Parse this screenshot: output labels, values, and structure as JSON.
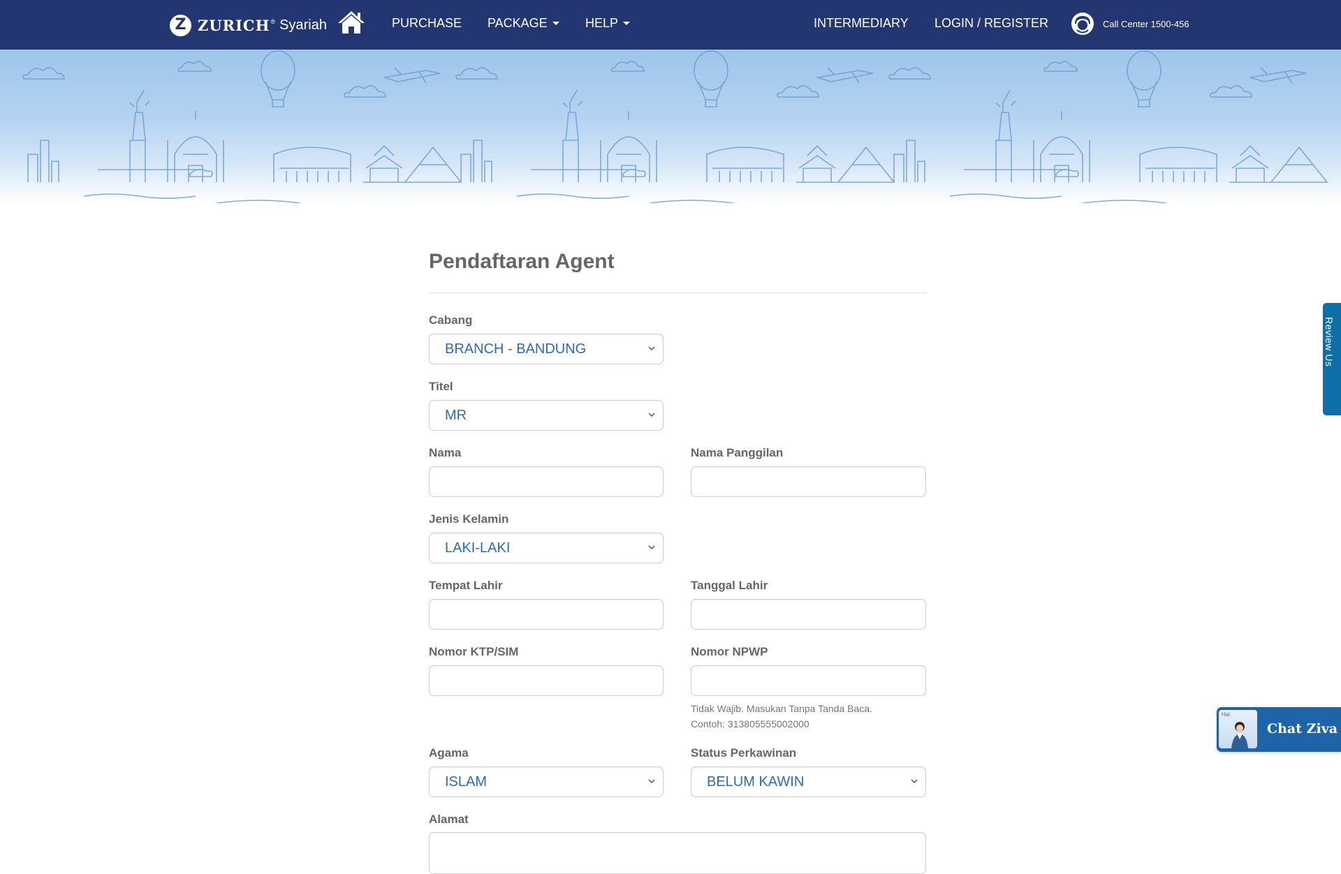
{
  "nav": {
    "logo_text": "ZURICH",
    "logo_sup": "®",
    "logo_sub": "Syariah",
    "purchase": "PURCHASE",
    "package": "PACKAGE",
    "help": "HELP",
    "intermediary": "INTERMEDIARY",
    "login": "LOGIN / REGISTER",
    "call_center": "Call Center 1500-456"
  },
  "form": {
    "title": "Pendaftaran Agent",
    "cabang_label": "Cabang",
    "cabang_value": "BRANCH - BANDUNG",
    "titel_label": "Titel",
    "titel_value": "MR",
    "nama_label": "Nama",
    "panggilan_label": "Nama Panggilan",
    "kelamin_label": "Jenis Kelamin",
    "kelamin_value": "LAKI-LAKI",
    "tempat_label": "Tempat Lahir",
    "tanggal_label": "Tanggal Lahir",
    "ktp_label": "Nomor KTP/SIM",
    "npwp_label": "Nomor NPWP",
    "npwp_help_1": "Tidak Wajib. Masukan Tanpa Tanda Baca.",
    "npwp_help_2": "Contoh: 313805555002000",
    "agama_label": "Agama",
    "agama_value": "ISLAM",
    "status_label": "Status Perkawinan",
    "status_value": "BELUM KAWIN",
    "alamat_label": "Alamat"
  },
  "widgets": {
    "review": "Review Us",
    "chat": "Chat Ziva",
    "chat_greeting": "Hai"
  },
  "colors": {
    "navbar": "#233672",
    "select_text": "#2b6cb8",
    "review_tab": "#0e6fa8",
    "chat_button": "#1d64a8"
  }
}
